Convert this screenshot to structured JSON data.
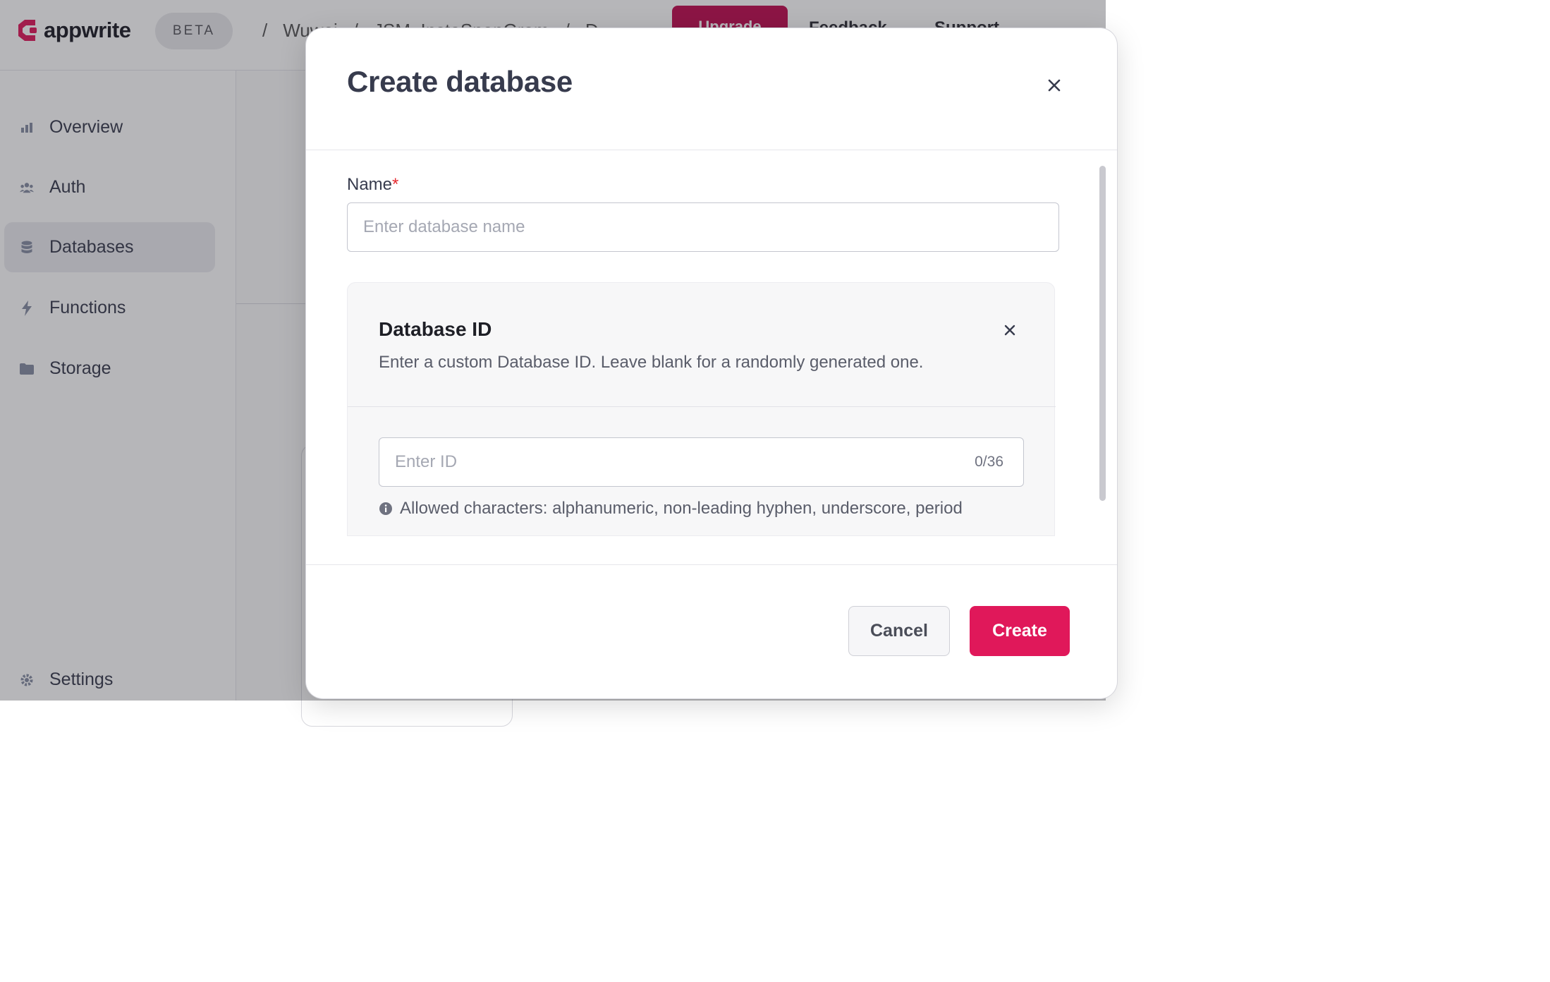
{
  "app": {
    "brand": "appwrite",
    "badge": "BETA",
    "brand_color": "#e0185a",
    "breadcrumb": [
      "/",
      "Wuwei",
      "/",
      "JSM_InstaSnapGram",
      "/",
      "D"
    ],
    "upgrade_label": "Upgrade",
    "feedback_label": "Feedback",
    "support_label": "Support"
  },
  "sidebar": {
    "items": [
      {
        "label": "Overview",
        "icon": "bar-chart-icon"
      },
      {
        "label": "Auth",
        "icon": "users-icon"
      },
      {
        "label": "Databases",
        "icon": "database-icon",
        "active": true
      },
      {
        "label": "Functions",
        "icon": "lightning-icon"
      },
      {
        "label": "Storage",
        "icon": "folder-icon"
      }
    ],
    "settings_label": "Settings"
  },
  "modal": {
    "title": "Create database",
    "name_label": "Name",
    "required_mark": "*",
    "name_placeholder": "Enter database name",
    "database_id": {
      "title": "Database ID",
      "description": "Enter a custom Database ID. Leave blank for a randomly generated one.",
      "placeholder": "Enter ID",
      "counter": "0/36",
      "help": "Allowed characters: alphanumeric, non-leading hyphen, underscore, period"
    },
    "cancel_label": "Cancel",
    "create_label": "Create"
  }
}
